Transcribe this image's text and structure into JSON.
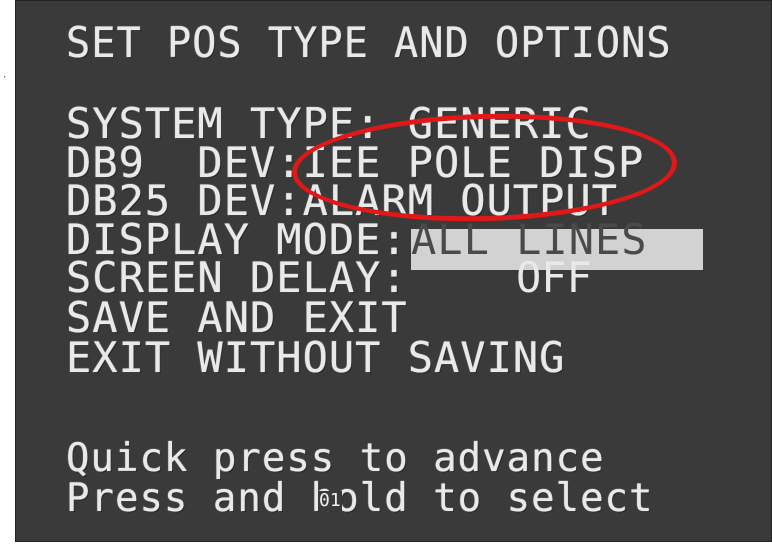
{
  "osd": {
    "title": "SET POS TYPE AND OPTIONS",
    "menu": {
      "system_type": "SYSTEM TYPE: GENERIC",
      "db9_dev": "DB9  DEV:IEE POLE DISP",
      "db25_dev": "DB25 DEV:ALARM OUTPUT",
      "display_mode_label": "DISPLAY MODE:",
      "display_mode_value": "ALL LINES",
      "screen_delay_label": "SCREEN DELAY:",
      "screen_delay_value": "OFF",
      "save_and_exit": "SAVE AND EXIT",
      "exit_without_saving": "EXIT WITHOUT SAVING"
    },
    "hints": {
      "quick_press": "Quick press to advance",
      "press_hold": "Press and hold to select"
    },
    "overlay_mark": "01",
    "side_mark": "·"
  },
  "annotation": {
    "circle_color": "#e01818"
  },
  "colors": {
    "screen_bg": "#3a3a3a",
    "osd_text": "#e9e9e9",
    "highlight_bg": "#d2d2d2",
    "highlight_text": "#4a4a4a"
  }
}
